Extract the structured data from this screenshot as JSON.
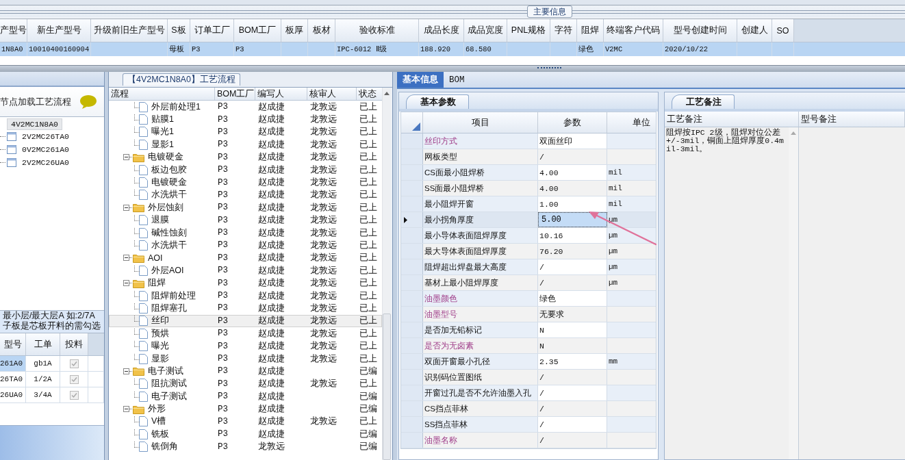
{
  "main_info": {
    "group_label": "主要信息",
    "columns": [
      "产型号",
      "新生产型号",
      "升级前旧生产型号",
      "S板",
      "订单工厂",
      "BOM工厂",
      "板厚",
      "板材",
      "验收标准",
      "成品长度",
      "成品宽度",
      "PNL规格",
      "字符",
      "阻焊",
      "终端客户代码",
      "型号创建时间",
      "创建人",
      "SO"
    ],
    "rows": [
      {
        "cells": [
          "1N8A0",
          "10010400160904",
          null,
          "母板",
          "P3",
          "P3",
          null,
          null,
          "IPC-6012 Ⅱ级",
          "188.920",
          "68.580",
          null,
          null,
          "绿色",
          "V2MC",
          "2020/10/22",
          null,
          null
        ],
        "selected": true
      }
    ]
  },
  "left_panel": {
    "title": "节点加载工艺流程",
    "tree": [
      {
        "label": "4V2MC1N8A0",
        "selected": true,
        "children": [
          {
            "label": "2V2MC26TA0",
            "selected": false
          },
          {
            "label": "0V2MC261A0",
            "selected": false
          },
          {
            "label": "2V2MC26UA0",
            "selected": false
          }
        ]
      }
    ],
    "hint": [
      "最小层/最大层A 如:2/7A",
      "子板是芯板开料的需勾选"
    ],
    "table": {
      "columns": [
        "型号",
        "工单",
        "投料"
      ],
      "rows": [
        {
          "model": "261A0",
          "order": "gb1A",
          "checked": true,
          "disabled": true,
          "selected": true
        },
        {
          "model": "26TA0",
          "order": "1/2A",
          "checked": true,
          "disabled": true,
          "selected": false
        },
        {
          "model": "26UA0",
          "order": "3/4A",
          "checked": true,
          "disabled": true,
          "selected": false
        }
      ]
    }
  },
  "flow": {
    "title": "【4V2MC1N8A0】工艺流程",
    "columns": [
      "流程",
      "BOM工厂",
      "编写人",
      "核审人",
      "状态"
    ],
    "rows": [
      {
        "kind": "step",
        "name": "外层前处理1",
        "factory": "P3",
        "author": "赵成捷",
        "reviewer": "龙敦远",
        "status": "已上",
        "selected": false
      },
      {
        "kind": "step",
        "name": "贴膜1",
        "factory": "P3",
        "author": "赵成捷",
        "reviewer": "龙敦远",
        "status": "已上",
        "selected": false
      },
      {
        "kind": "step",
        "name": "曝光1",
        "factory": "P3",
        "author": "赵成捷",
        "reviewer": "龙敦远",
        "status": "已上",
        "selected": false
      },
      {
        "kind": "step",
        "name": "显影1",
        "factory": "P3",
        "author": "赵成捷",
        "reviewer": "龙敦远",
        "status": "已上",
        "selected": false
      },
      {
        "kind": "folder",
        "name": "电镀硬金",
        "factory": "P3",
        "author": "赵成捷",
        "reviewer": "龙敦远",
        "status": "已上",
        "selected": false,
        "expanded": true,
        "children": [
          {
            "kind": "step",
            "name": "板边包胶",
            "factory": "P3",
            "author": "赵成捷",
            "reviewer": "龙敦远",
            "status": "已上",
            "selected": false
          },
          {
            "kind": "step",
            "name": "电镀硬金",
            "factory": "P3",
            "author": "赵成捷",
            "reviewer": "龙敦远",
            "status": "已上",
            "selected": false
          },
          {
            "kind": "step",
            "name": "水洗烘干",
            "factory": "P3",
            "author": "赵成捷",
            "reviewer": "龙敦远",
            "status": "已上",
            "selected": false
          }
        ]
      },
      {
        "kind": "folder",
        "name": "外层蚀刻",
        "factory": "P3",
        "author": "赵成捷",
        "reviewer": "龙敦远",
        "status": "已上",
        "selected": false,
        "expanded": true,
        "children": [
          {
            "kind": "step",
            "name": "退膜",
            "factory": "P3",
            "author": "赵成捷",
            "reviewer": "龙敦远",
            "status": "已上",
            "selected": false
          },
          {
            "kind": "step",
            "name": "碱性蚀刻",
            "factory": "P3",
            "author": "赵成捷",
            "reviewer": "龙敦远",
            "status": "已上",
            "selected": false
          },
          {
            "kind": "step",
            "name": "水洗烘干",
            "factory": "P3",
            "author": "赵成捷",
            "reviewer": "龙敦远",
            "status": "已上",
            "selected": false
          }
        ]
      },
      {
        "kind": "folder",
        "name": "AOI",
        "factory": "P3",
        "author": "赵成捷",
        "reviewer": "龙敦远",
        "status": "已上",
        "selected": false,
        "expanded": true,
        "children": [
          {
            "kind": "step",
            "name": "外层AOI",
            "factory": "P3",
            "author": "赵成捷",
            "reviewer": "龙敦远",
            "status": "已上",
            "selected": false
          }
        ]
      },
      {
        "kind": "folder",
        "name": "阻焊",
        "factory": "P3",
        "author": "赵成捷",
        "reviewer": "龙敦远",
        "status": "已上",
        "selected": false,
        "expanded": true,
        "children": [
          {
            "kind": "step",
            "name": "阻焊前处理",
            "factory": "P3",
            "author": "赵成捷",
            "reviewer": "龙敦远",
            "status": "已上",
            "selected": false
          },
          {
            "kind": "step",
            "name": "阻焊塞孔",
            "factory": "P3",
            "author": "赵成捷",
            "reviewer": "龙敦远",
            "status": "已上",
            "selected": false
          },
          {
            "kind": "step",
            "name": "丝印",
            "factory": "P3",
            "author": "赵成捷",
            "reviewer": "龙敦远",
            "status": "已上",
            "selected": true
          },
          {
            "kind": "step",
            "name": "预烘",
            "factory": "P3",
            "author": "赵成捷",
            "reviewer": "龙敦远",
            "status": "已上",
            "selected": false
          },
          {
            "kind": "step",
            "name": "曝光",
            "factory": "P3",
            "author": "赵成捷",
            "reviewer": "龙敦远",
            "status": "已上",
            "selected": false
          },
          {
            "kind": "step",
            "name": "显影",
            "factory": "P3",
            "author": "赵成捷",
            "reviewer": "龙敦远",
            "status": "已上",
            "selected": false
          }
        ]
      },
      {
        "kind": "folder",
        "name": "电子测试",
        "factory": "P3",
        "author": "赵成捷",
        "status": "已编",
        "selected": false,
        "expanded": true,
        "children": [
          {
            "kind": "step",
            "name": "阻抗测试",
            "factory": "P3",
            "author": "赵成捷",
            "reviewer": "龙敦远",
            "status": "已上",
            "selected": false
          },
          {
            "kind": "step",
            "name": "电子测试",
            "factory": "P3",
            "author": "赵成捷",
            "status": "已编",
            "selected": false
          }
        ]
      },
      {
        "kind": "folder",
        "name": "外形",
        "factory": "P3",
        "author": "赵成捷",
        "status": "已编",
        "selected": false,
        "expanded": true,
        "children": [
          {
            "kind": "step",
            "name": "V槽",
            "factory": "P3",
            "author": "赵成捷",
            "reviewer": "龙敦远",
            "status": "已上",
            "selected": false
          },
          {
            "kind": "step",
            "name": "铣板",
            "factory": "P3",
            "author": "赵成捷",
            "status": "已编",
            "selected": false
          },
          {
            "kind": "step",
            "name": "铣倒角",
            "factory": "P3",
            "author": "龙敦远",
            "status": "已编",
            "selected": false
          }
        ]
      }
    ]
  },
  "detail": {
    "tabs": [
      {
        "label": "基本信息",
        "selected": true
      },
      {
        "label": "BOM",
        "selected": false
      }
    ],
    "params": {
      "tab": "基本参数",
      "columns": [
        "项目",
        "参数",
        "单位"
      ],
      "rows": [
        {
          "item": "丝印方式",
          "value": "双面丝印",
          "required": true,
          "current": false
        },
        {
          "item": "网板类型",
          "value": "/",
          "required": false,
          "current": false
        },
        {
          "item": "CS面最小阻焊桥",
          "value": "4.00",
          "unit": "mil",
          "required": false,
          "current": false
        },
        {
          "item": "SS面最小阻焊桥",
          "value": "4.00",
          "unit": "mil",
          "required": false,
          "current": false
        },
        {
          "item": "最小阻焊开窗",
          "value": "1.00",
          "unit": "mil",
          "required": false,
          "current": false
        },
        {
          "item": "最小拐角厚度",
          "value": "5.00",
          "unit": "µm",
          "required": false,
          "current": true
        },
        {
          "item": "最小导体表面阻焊厚度",
          "value": "10.16",
          "unit": "µm",
          "required": false,
          "current": false
        },
        {
          "item": "最大导体表面阻焊厚度",
          "value": "76.20",
          "unit": "µm",
          "required": false,
          "current": false
        },
        {
          "item": "阻焊超出焊盘最大高度",
          "value": "/",
          "unit": "µm",
          "required": false,
          "current": false
        },
        {
          "item": "基材上最小阻焊厚度",
          "value": "/",
          "unit": "µm",
          "required": false,
          "current": false
        },
        {
          "item": "油墨颜色",
          "value": "绿色",
          "required": true,
          "current": false
        },
        {
          "item": "油墨型号",
          "value": "无要求",
          "required": true,
          "current": false
        },
        {
          "item": "是否加无铅标记",
          "value": "N",
          "required": false,
          "current": false
        },
        {
          "item": "是否为无卤素",
          "value": "N",
          "required": true,
          "current": false
        },
        {
          "item": "双面开窗最小孔径",
          "value": "2.35",
          "unit": "mm",
          "required": false,
          "current": false
        },
        {
          "item": "识别码位置图纸",
          "value": "/",
          "required": false,
          "current": false
        },
        {
          "item": "开窗过孔是否不允许油墨入孔",
          "value": "/",
          "required": false,
          "current": false
        },
        {
          "item": "CS挡点菲林",
          "value": "/",
          "required": false,
          "current": false
        },
        {
          "item": "SS挡点菲林",
          "value": "/",
          "required": false,
          "current": false
        },
        {
          "item": "油墨名称",
          "value": "/",
          "required": true,
          "current": false
        }
      ]
    },
    "notes": {
      "tab": "工艺备注",
      "columns": [
        "工艺备注",
        "型号备注"
      ],
      "process_note": "阻焊按IPC 2级，阻焊对位公差+/-3mil，铜面上阻焊厚度0.4mil-3mil。"
    }
  }
}
